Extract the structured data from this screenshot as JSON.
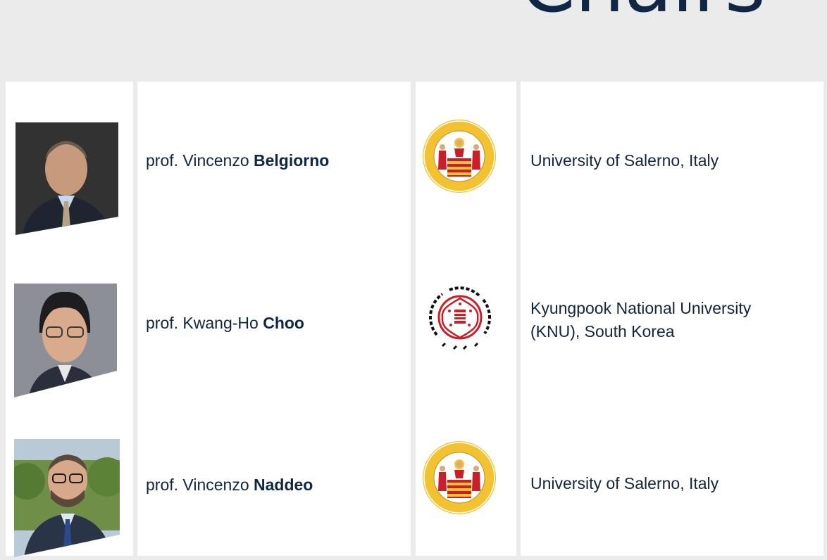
{
  "header": {
    "title": "Chairs"
  },
  "chairs": [
    {
      "prefix": "prof. Vincenzo ",
      "surname": "Belgiorno",
      "institution_line1": "University of Salerno, Italy",
      "institution_line2": "",
      "photo_icon": "portrait-photo",
      "logo_icon": "university-of-salerno-seal"
    },
    {
      "prefix": "prof. Kwang-Ho ",
      "surname": "Choo",
      "institution_line1": "Kyungpook National University",
      "institution_line2": "(KNU), South Korea",
      "photo_icon": "portrait-photo",
      "logo_icon": "kyungpook-national-university-seal"
    },
    {
      "prefix": "prof. Vincenzo ",
      "surname": "Naddeo",
      "institution_line1": "University of Salerno, Italy",
      "institution_line2": "",
      "photo_icon": "portrait-photo",
      "logo_icon": "university-of-salerno-seal"
    }
  ],
  "colors": {
    "background": "#ebebeb",
    "heading": "#0f2744",
    "salerno_gold": "#f2c230",
    "salerno_red": "#c8202a",
    "knu_red": "#c8202a"
  }
}
